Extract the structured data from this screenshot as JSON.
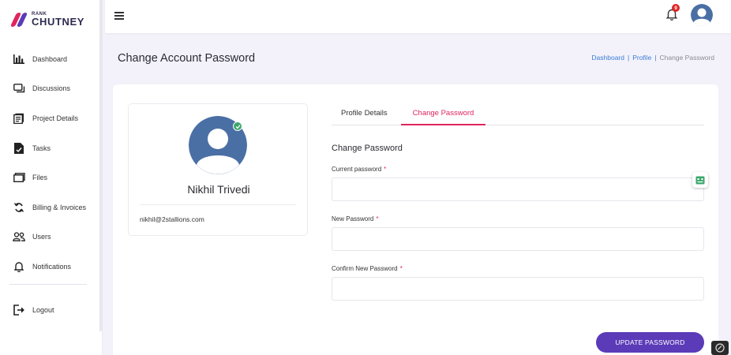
{
  "logo": {
    "top_text": "RANK",
    "brand_text": "CHUTNEY"
  },
  "sidebar": {
    "items": [
      {
        "label": "Dashboard",
        "icon": "bar-chart-icon"
      },
      {
        "label": "Discussions",
        "icon": "chat-icon"
      },
      {
        "label": "Project Details",
        "icon": "document-icon"
      },
      {
        "label": "Tasks",
        "icon": "tasks-icon"
      },
      {
        "label": "Files",
        "icon": "folder-icon"
      },
      {
        "label": "Billing & Invoices",
        "icon": "refresh-icon"
      },
      {
        "label": "Users",
        "icon": "users-icon"
      },
      {
        "label": "Notifications",
        "icon": "bell-icon"
      }
    ],
    "logout_label": "Logout"
  },
  "topbar": {
    "notification_count": "9"
  },
  "page": {
    "title": "Change Account Password"
  },
  "breadcrumb": {
    "items": [
      "Dashboard",
      "Profile",
      "Change Password"
    ],
    "separator": "|"
  },
  "profile": {
    "name": "Nikhil Trivedi",
    "email": "nikhil@2stallions.com"
  },
  "tabs": [
    {
      "label": "Profile Details",
      "active": false
    },
    {
      "label": "Change Password",
      "active": true
    }
  ],
  "form": {
    "section_title": "Change Password",
    "fields": [
      {
        "label": "Current password",
        "required_mark": "*",
        "value": ""
      },
      {
        "label": "New Password",
        "required_mark": "*",
        "value": ""
      },
      {
        "label": "Confirm New Password",
        "required_mark": "*",
        "value": ""
      }
    ],
    "submit_label": "UPDATE PASSWORD"
  },
  "colors": {
    "accent": "#e0245e",
    "primary": "#5b3bb8",
    "link": "#3a7bd5",
    "avatar": "#4a6fa5"
  }
}
